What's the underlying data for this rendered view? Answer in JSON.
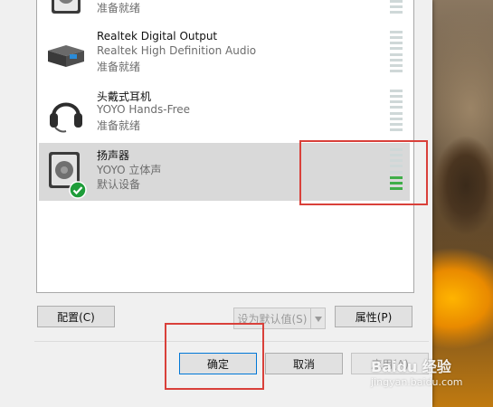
{
  "devices": [
    {
      "name": "",
      "subtitle": "",
      "status": "准备就绪",
      "icon": "speaker-icon",
      "meter_level": 0
    },
    {
      "name": "Realtek Digital Output",
      "subtitle": "Realtek High Definition Audio",
      "status": "准备就绪",
      "icon": "digital-output-icon",
      "meter_level": 0
    },
    {
      "name": "头戴式耳机",
      "subtitle": "YOYO Hands-Free",
      "status": "准备就绪",
      "icon": "headset-icon",
      "meter_level": 0
    },
    {
      "name": "扬声器",
      "subtitle": "YOYO 立体声",
      "status": "默认设备",
      "icon": "speaker-icon",
      "meter_level": 0.4,
      "default": true,
      "selected": true
    }
  ],
  "buttons": {
    "configure": "配置(C)",
    "set_default": "设为默认值(S)",
    "properties": "属性(P)",
    "ok": "确定",
    "cancel": "取消",
    "apply": "应用(A)"
  },
  "watermark": {
    "logo": "Baidu 经验",
    "url": "jingyan.baidu.com"
  },
  "colors": {
    "highlight_box": "#d9403a",
    "meter_on": "#3fae49",
    "selected_bg": "#d9d9d9"
  }
}
